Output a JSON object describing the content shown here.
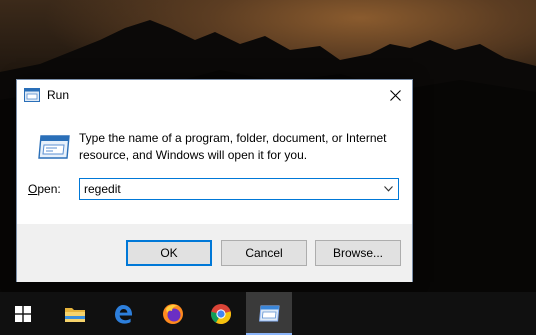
{
  "dialog": {
    "title": "Run",
    "description": "Type the name of a program, folder, document, or Internet resource, and Windows will open it for you.",
    "open_label_mnemonic": "O",
    "open_label_rest": "pen:",
    "open_value": "regedit",
    "ok_label": "OK",
    "cancel_label": "Cancel",
    "browse_label": "Browse...",
    "accent_color": "#0078d7"
  },
  "taskbar": {
    "items": [
      {
        "icon": "windows-start-icon"
      },
      {
        "icon": "file-explorer-icon"
      },
      {
        "icon": "edge-icon"
      },
      {
        "icon": "firefox-icon"
      },
      {
        "icon": "chrome-icon"
      },
      {
        "icon": "run-icon",
        "active": true
      }
    ],
    "background": "#101010"
  }
}
